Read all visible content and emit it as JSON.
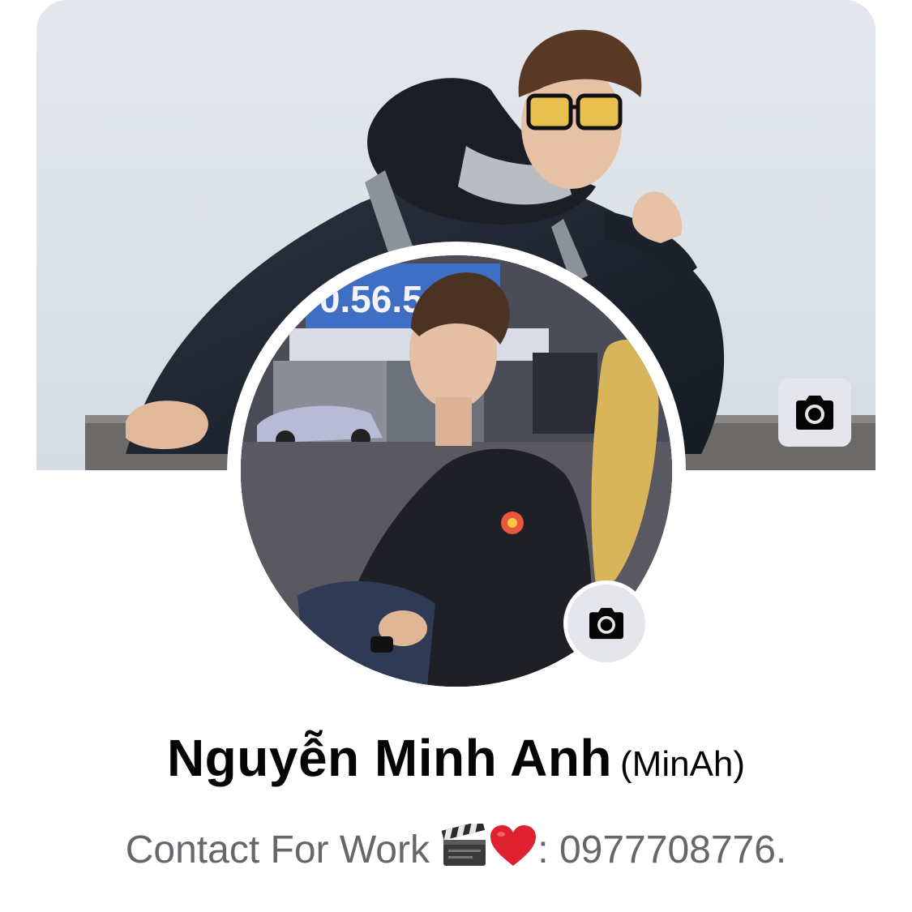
{
  "cover_photo": {
    "alt": "cover-photo",
    "edit_icon": "camera-icon"
  },
  "profile_picture": {
    "edit_icon": "camera-icon",
    "sign_text": "0.56.56."
  },
  "profile": {
    "name": "Nguyễn Minh Anh",
    "alternate_name": "(MinAh)",
    "bio_prefix": "Contact For Work",
    "bio_emojis": [
      "clapper-board-icon",
      "red-heart-icon"
    ],
    "bio_suffix": ": 0977708776."
  },
  "colors": {
    "name_text": "#050505",
    "secondary_text": "#65676b",
    "button_bg": "#e4e6eb"
  }
}
